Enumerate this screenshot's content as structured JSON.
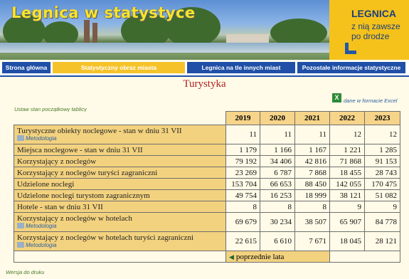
{
  "banner": {
    "title": "Legnica w statystyce",
    "logo_city": "LEGNICA",
    "logo_slogan": "z nią zawsze po drodze"
  },
  "nav": {
    "items": [
      {
        "label": "Strona główna"
      },
      {
        "label": "Statystyczny obraz miasta"
      },
      {
        "label": "Legnica na tle innych miast"
      },
      {
        "label": "Pozostałe informacje statystyczne"
      }
    ]
  },
  "page": {
    "title": "Turystyka",
    "excel_link": "dane w formacie Excel",
    "reset_link": "Ustaw stan początkowy tablicy",
    "print_link": "Wersja do druku",
    "prev_years": "poprzednie lata"
  },
  "table": {
    "years": [
      "2019",
      "2020",
      "2021",
      "2022",
      "2023"
    ],
    "rows": [
      {
        "label": "Turystyczne obiekty noclegowe - stan w dniu 31 VII",
        "meta": "Metodologia",
        "values": [
          "11",
          "11",
          "11",
          "12",
          "12"
        ]
      },
      {
        "label": "Miejsca noclegowe - stan w dniu 31 VII",
        "meta": "",
        "values": [
          "1 179",
          "1 166",
          "1 167",
          "1 221",
          "1 285"
        ]
      },
      {
        "label": "Korzystający z noclegów",
        "meta": "",
        "values": [
          "79 192",
          "34 406",
          "42 816",
          "71 868",
          "91 153"
        ]
      },
      {
        "label": "Korzystający z noclegów turyści zagraniczni",
        "meta": "",
        "values": [
          "23 269",
          "6 787",
          "7 868",
          "18 455",
          "28 743"
        ]
      },
      {
        "label": "Udzielone noclegi",
        "meta": "",
        "values": [
          "153 704",
          "66 653",
          "88 450",
          "142 055",
          "170 475"
        ]
      },
      {
        "label": "Udzielone noclegi turystom zagranicznym",
        "meta": "",
        "values": [
          "49 754",
          "16 253",
          "18 999",
          "38 121",
          "51 082"
        ]
      },
      {
        "label": "Hotele - stan w dniu 31 VII",
        "meta": "",
        "values": [
          "8",
          "8",
          "8",
          "9",
          "9"
        ]
      },
      {
        "label": "Korzystający z noclegów w hotelach",
        "meta": "Metodologia",
        "values": [
          "69 679",
          "30 234",
          "38 507",
          "65 907",
          "84 778"
        ]
      },
      {
        "label": "Korzystający z noclegów w hotelach turyści zagraniczni",
        "meta": "Metodologia",
        "values": [
          "22 615",
          "6 610",
          "7 671",
          "18 045",
          "28 121"
        ]
      }
    ]
  },
  "colors": {
    "nav_blue": "#1f4fa6",
    "nav_active": "#f6c22a",
    "title_red": "#b02020",
    "label_bg": "#f3d27f",
    "page_bg": "#fffbe8"
  }
}
